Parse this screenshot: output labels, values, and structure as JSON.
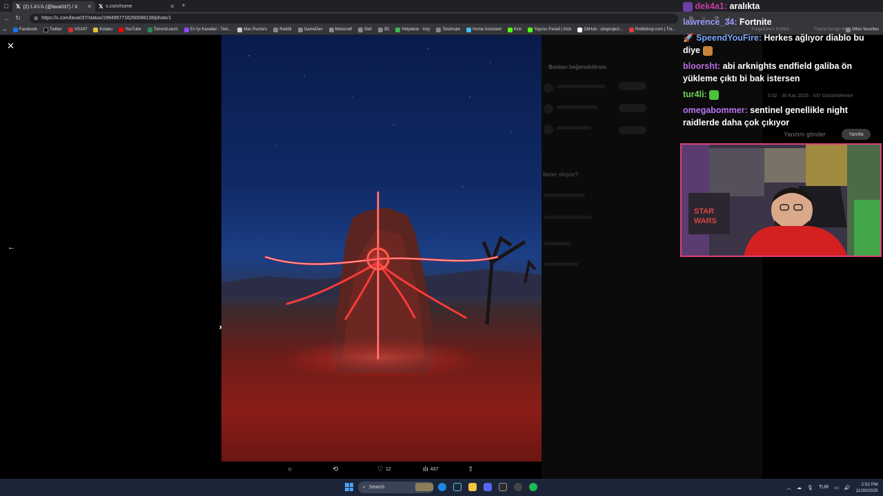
{
  "browser": {
    "tabs": [
      {
        "title": "(2) 𝕃𝔸𝕍𝔸 (@lava037) / X",
        "active": true
      },
      {
        "title": "x.com/home",
        "active": false
      }
    ],
    "url": "https://x.com/lava037/status/1994957716260098138/photo/1",
    "bookmarks": [
      "Facebook",
      "Twitter",
      "VG247",
      "Kotaku",
      "YouTube",
      "TorrentLeech",
      "En İyi Kanallar - Twit...",
      "Mac Rumors",
      "Reddit",
      "GameDev",
      "Minecraft",
      "Dell",
      "3D",
      "Helpdesk · Icky",
      "Testimate",
      "Home Assistant",
      "Kick",
      "Yayıncı Paneli | Kick",
      "GitHub - obsproject...",
      "Robitshop.com | Tür..."
    ],
    "other_bookmarks": "Other favorites"
  },
  "viewer": {
    "close_icon": "close-icon",
    "prev_icon": "arrow-left-icon"
  },
  "actions": {
    "reply_count": "",
    "retweet_count": "",
    "like_count": "12",
    "views_count": "437"
  },
  "chat": [
    {
      "user": "dek4a1:",
      "message": "aralıkta",
      "color": "#c93aa5"
    },
    {
      "user": "lawrence_34:",
      "message": "Fortnite",
      "color": "#9b9bff"
    },
    {
      "user": "SpeendYouFire:",
      "message": "Herkes ağlıyor diablo bu diye",
      "color": "#7aa8ff"
    },
    {
      "user": "bloorsht:",
      "message": "abi arknights endfield galiba ön yükleme çıktı bi bak istersen",
      "color": "#b66bdf"
    },
    {
      "user": "tur4li:",
      "message": "",
      "color": "#6fd15a"
    },
    {
      "user": "omegabommer:",
      "message": "sentinel genellikle night raidlerde daha çok çıkıyor",
      "color": "#b874f0"
    }
  ],
  "ghost_ui": {
    "might_like": "Bunları beğenebilirsin",
    "timestamp": "5:02 · 30 Kas 2025 · 437 Görüntülenme",
    "reply_placeholder": "Yanıtını gönder",
    "reply_button": "Yanıtla",
    "whats_happening": "Neler oluyor?",
    "ghost_views": "437",
    "ghost_forge": "ForgeCore's Portfoli...",
    "ghost_fractal": "Fractal Design Nort...",
    "ghost_likes": "17",
    "ghost_views2": "839"
  },
  "taskbar": {
    "search": "Search",
    "language": "TUR",
    "time": "2:52 PM",
    "date": "11/30/2025"
  },
  "colors": {
    "accent": "#1d9bf0",
    "webcam_border": "#e0417a"
  }
}
